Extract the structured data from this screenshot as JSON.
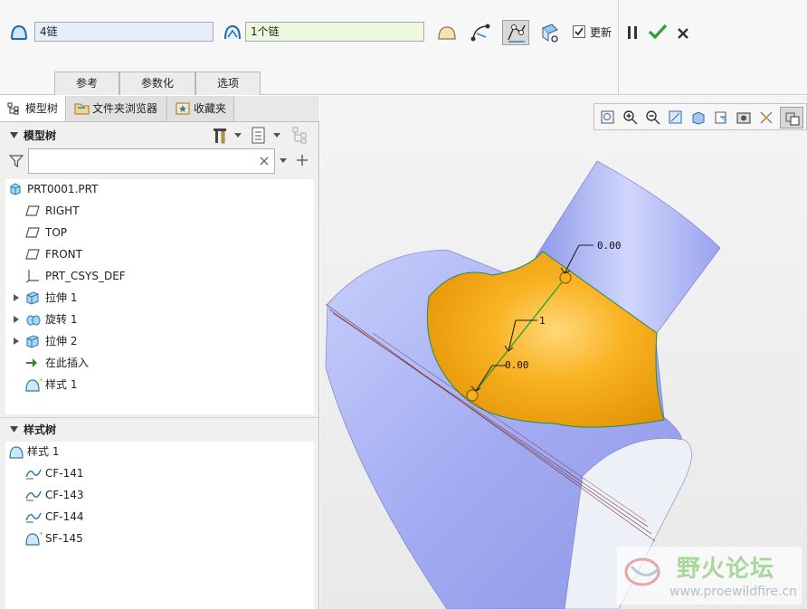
{
  "dashboard": {
    "chain_field": "4链",
    "chain_count_field": "1个链",
    "update_label": "更新",
    "update_checked": true,
    "tabs": [
      "参考",
      "参数化",
      "选项"
    ]
  },
  "panel_tabs": [
    "模型树",
    "文件夹浏览器",
    "收藏夹"
  ],
  "model_tree": {
    "header": "模型树",
    "filter_placeholder": "",
    "items": [
      {
        "label": "PRT0001.PRT",
        "icon": "part-icon"
      },
      {
        "label": "RIGHT",
        "icon": "datum-plane-icon"
      },
      {
        "label": "TOP",
        "icon": "datum-plane-icon"
      },
      {
        "label": "FRONT",
        "icon": "datum-plane-icon"
      },
      {
        "label": "PRT_CSYS_DEF",
        "icon": "csys-icon"
      },
      {
        "label": "拉伸 1",
        "icon": "extrude-icon"
      },
      {
        "label": "旋转 1",
        "icon": "revolve-icon"
      },
      {
        "label": "拉伸 2",
        "icon": "extrude-icon"
      },
      {
        "label": "在此插入",
        "icon": "insert-arrow-icon"
      },
      {
        "label": "样式 1",
        "icon": "style-icon"
      }
    ]
  },
  "style_tree": {
    "header": "样式树",
    "items": [
      {
        "label": "样式 1",
        "icon": "style-icon"
      },
      {
        "label": "CF-141",
        "icon": "curve-icon"
      },
      {
        "label": "CF-143",
        "icon": "curve-icon"
      },
      {
        "label": "CF-144",
        "icon": "curve-icon"
      },
      {
        "label": "SF-145",
        "icon": "style-surface-icon"
      }
    ]
  },
  "viewport": {
    "dim_top": "0.00",
    "dim_mid": "1",
    "dim_bottom": "0.00",
    "watermark_title": "野火论坛",
    "watermark_url": "www.proewildfire.cn"
  },
  "colors": {
    "surface_blue": "#a7b0f5",
    "surface_orange": "#f4a50a",
    "accent_green": "#2ea02e"
  }
}
